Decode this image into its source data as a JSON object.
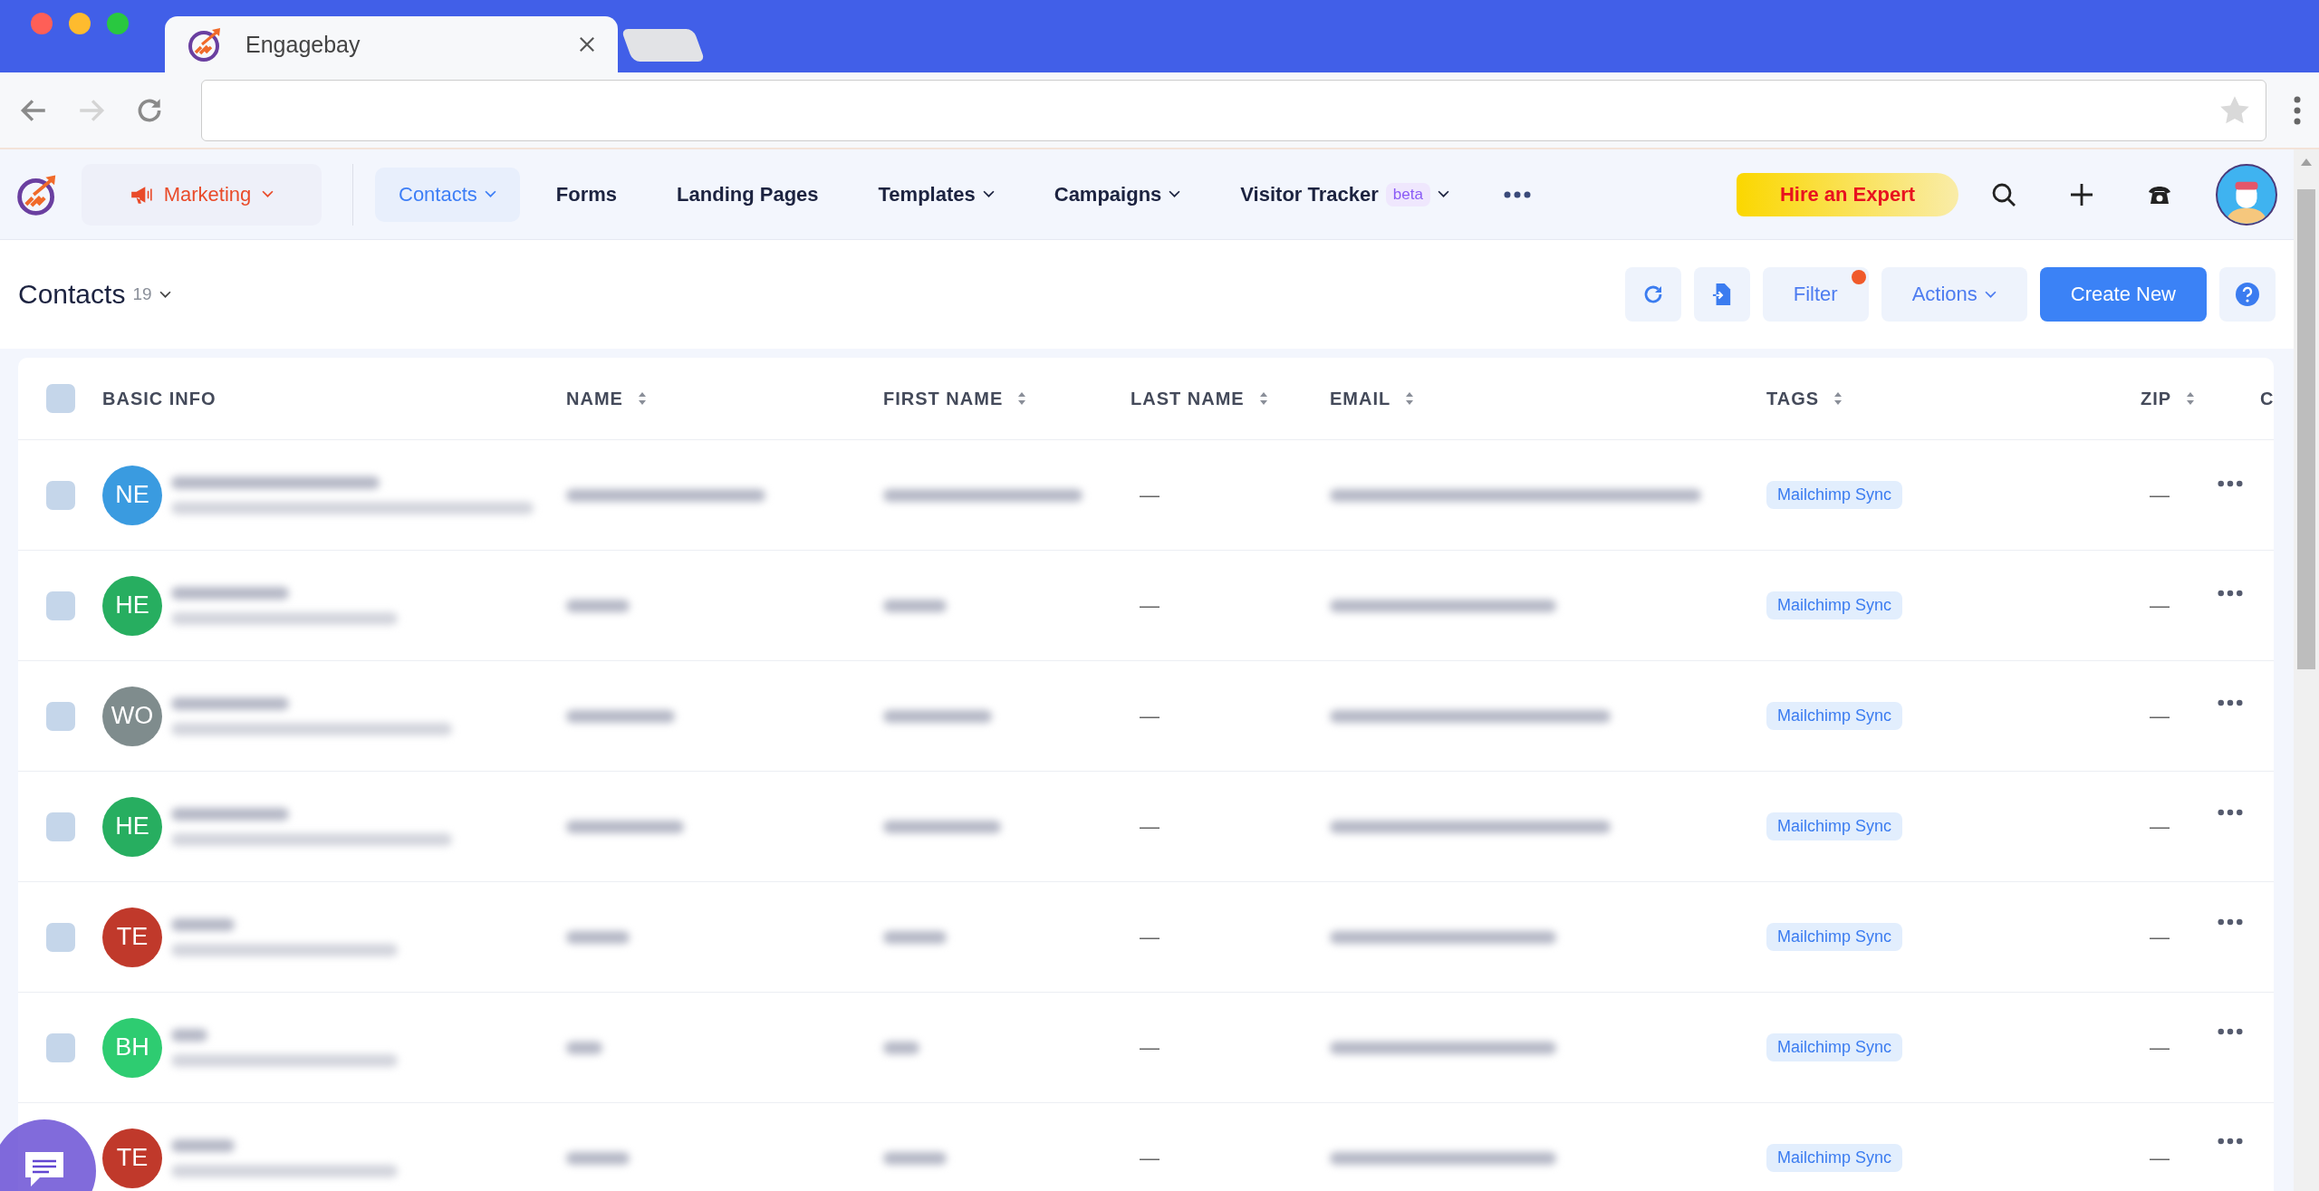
{
  "browser": {
    "tab_title": "Engagebay",
    "forward_disabled": true
  },
  "nav": {
    "module": "Marketing",
    "items": [
      {
        "label": "Contacts",
        "selected": true,
        "dropdown": true
      },
      {
        "label": "Forms",
        "selected": false,
        "dropdown": false
      },
      {
        "label": "Landing Pages",
        "selected": false,
        "dropdown": false
      },
      {
        "label": "Templates",
        "selected": false,
        "dropdown": true
      },
      {
        "label": "Campaigns",
        "selected": false,
        "dropdown": true
      },
      {
        "label": "Visitor Tracker",
        "selected": false,
        "dropdown": true,
        "badge": "beta"
      }
    ],
    "hire_button": "Hire an Expert"
  },
  "header": {
    "title": "Contacts",
    "count": "19",
    "filter": {
      "label": "Filter",
      "notification": true
    },
    "actions": "Actions",
    "create": "Create New"
  },
  "table": {
    "select_all_checked": false,
    "columns": [
      {
        "label": "BASIC INFO",
        "sortable": false
      },
      {
        "label": "NAME",
        "sortable": true
      },
      {
        "label": "FIRST NAME",
        "sortable": true
      },
      {
        "label": "LAST NAME",
        "sortable": true
      },
      {
        "label": "EMAIL",
        "sortable": true
      },
      {
        "label": "TAGS",
        "sortable": true
      },
      {
        "label": "ZIP",
        "sortable": true
      },
      {
        "label": "C",
        "sortable": false
      }
    ],
    "rows": [
      {
        "initials": "NE",
        "color": "#3a9be0",
        "checked": false,
        "last_name": "—",
        "tag": "Mailchimp Sync",
        "zip": "—"
      },
      {
        "initials": "HE",
        "color": "#27ae60",
        "checked": false,
        "last_name": "—",
        "tag": "Mailchimp Sync",
        "zip": "—"
      },
      {
        "initials": "WO",
        "color": "#7f8c8d",
        "checked": false,
        "last_name": "—",
        "tag": "Mailchimp Sync",
        "zip": "—"
      },
      {
        "initials": "HE",
        "color": "#27ae60",
        "checked": false,
        "last_name": "—",
        "tag": "Mailchimp Sync",
        "zip": "—"
      },
      {
        "initials": "TE",
        "color": "#c0392b",
        "checked": false,
        "last_name": "—",
        "tag": "Mailchimp Sync",
        "zip": "—"
      },
      {
        "initials": "BH",
        "color": "#2ecc71",
        "checked": false,
        "last_name": "—",
        "tag": "Mailchimp Sync",
        "zip": "—"
      },
      {
        "initials": "TE",
        "color": "#c0392b",
        "last_name": "—",
        "tag": "Mailchimp Sync",
        "zip": "—"
      }
    ]
  }
}
